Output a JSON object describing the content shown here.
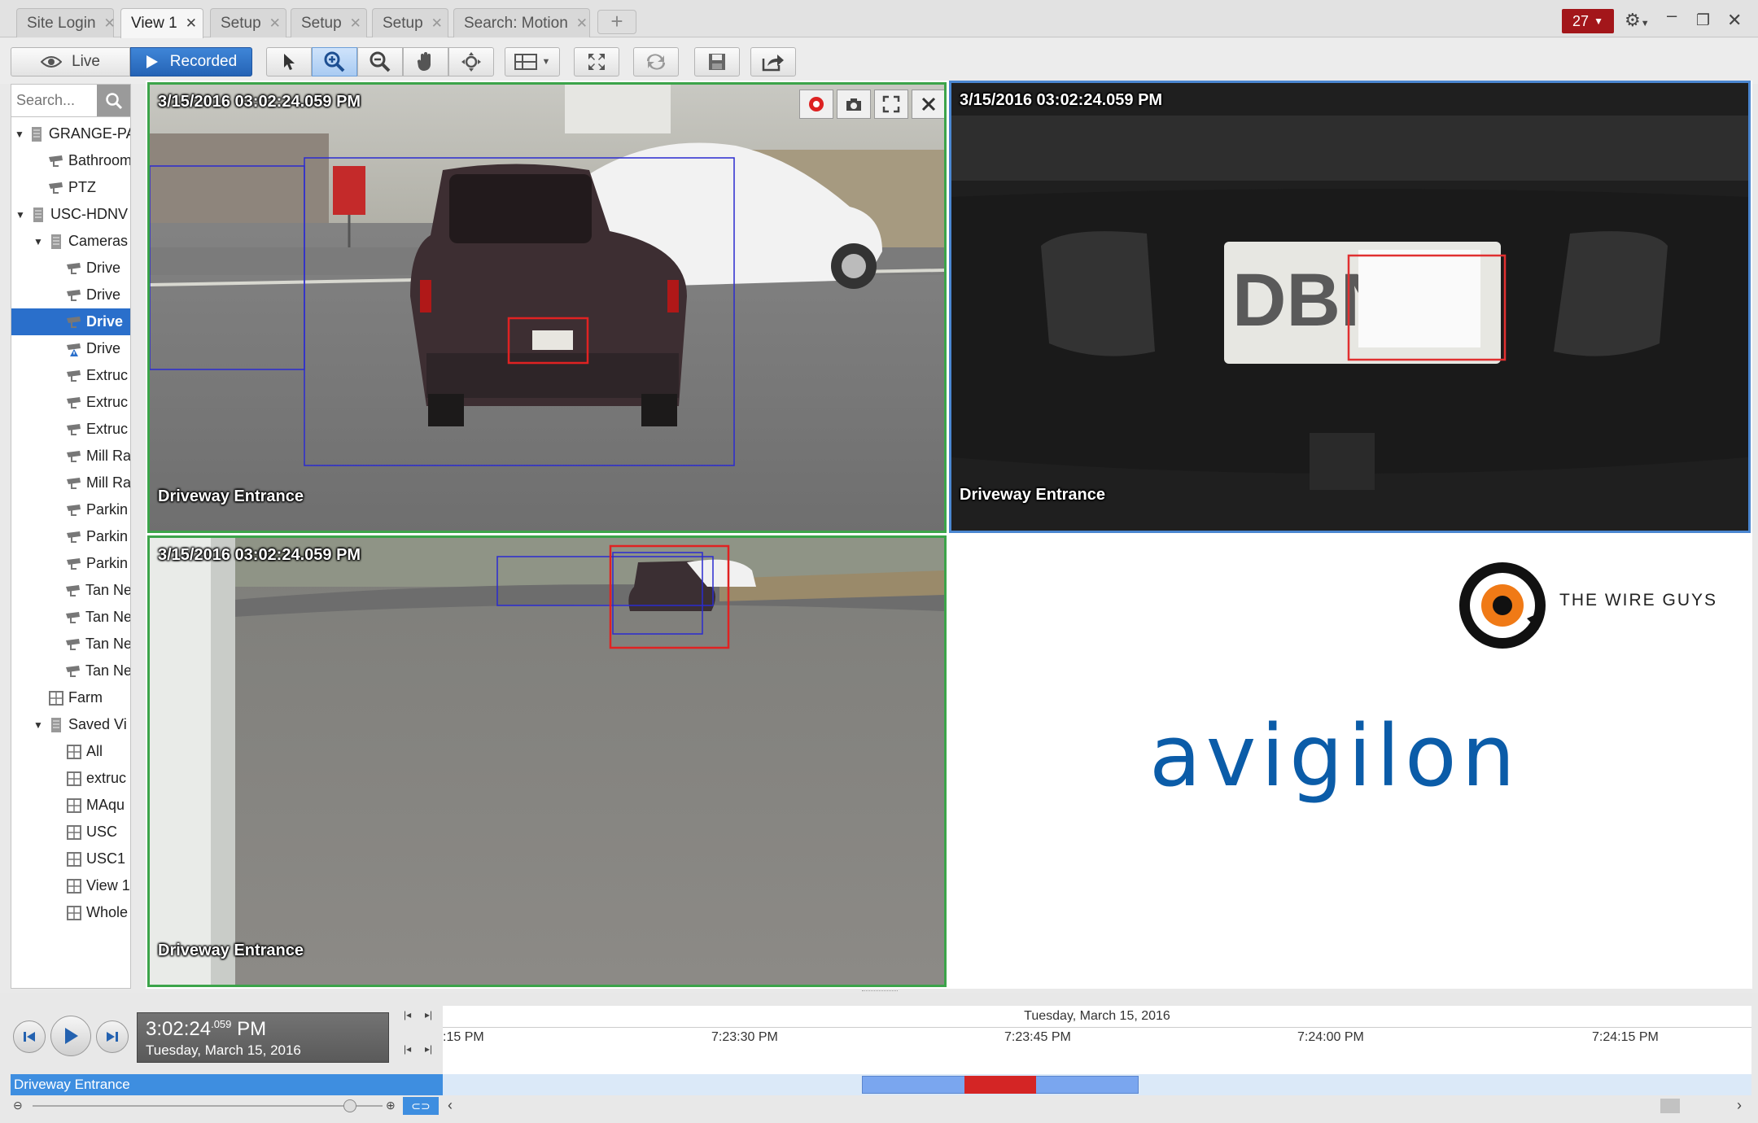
{
  "tabs": [
    {
      "label": "Site Login",
      "active": false
    },
    {
      "label": "View 1",
      "active": true
    },
    {
      "label": "Setup",
      "active": false
    },
    {
      "label": "Setup",
      "active": false
    },
    {
      "label": "Setup",
      "active": false
    },
    {
      "label": "Search: Motion",
      "active": false
    }
  ],
  "alarm_count": "27",
  "toolbar": {
    "live_label": "Live",
    "recorded_label": "Recorded"
  },
  "search": {
    "placeholder": "Search..."
  },
  "tree": [
    "GRANGE-PA",
    "Bathroom",
    "PTZ",
    "USC-HDNV",
    "Cameras",
    "Drive",
    "Drive",
    "Drive",
    "Drive",
    "Extruc",
    "Extruc",
    "Extruc",
    "Mill Ra",
    "Mill Ra",
    "Parkin",
    "Parkin",
    "Parkin",
    "Tan Ne",
    "Tan Ne",
    "Tan Ne",
    "Tan Ne",
    "Farm",
    "Saved Vi",
    "All",
    "extruc",
    "MAqu",
    "USC",
    "USC1",
    "View 1",
    "Whole"
  ],
  "tiles": {
    "timestamp": "3/15/2016 03:02:24.059 PM",
    "camera_name": "Driveway Entrance",
    "plate_text": "DBN-"
  },
  "branding": {
    "wire_guys": "THE WIRE GUYS",
    "avigilon": "avigilon"
  },
  "playback": {
    "time_main": "3:02:24",
    "time_ms": ".059",
    "time_ampm": "PM",
    "date": "Tuesday, March 15, 2016",
    "camera": "Driveway Entrance"
  },
  "timeline": {
    "date_header": "Tuesday, March 15, 2016",
    "labels": [
      ":15 PM",
      "7:23:30 PM",
      "7:23:45 PM",
      "7:24:00 PM",
      "7:24:15 PM"
    ]
  },
  "colors": {
    "accent": "#2a6fcb",
    "alarm": "#a3161a",
    "tile_active_green": "#3ca44a",
    "tile_selected_blue": "#4a86d0",
    "motion_red": "#cc2222",
    "avigilon_blue": "#0b5ca8"
  }
}
